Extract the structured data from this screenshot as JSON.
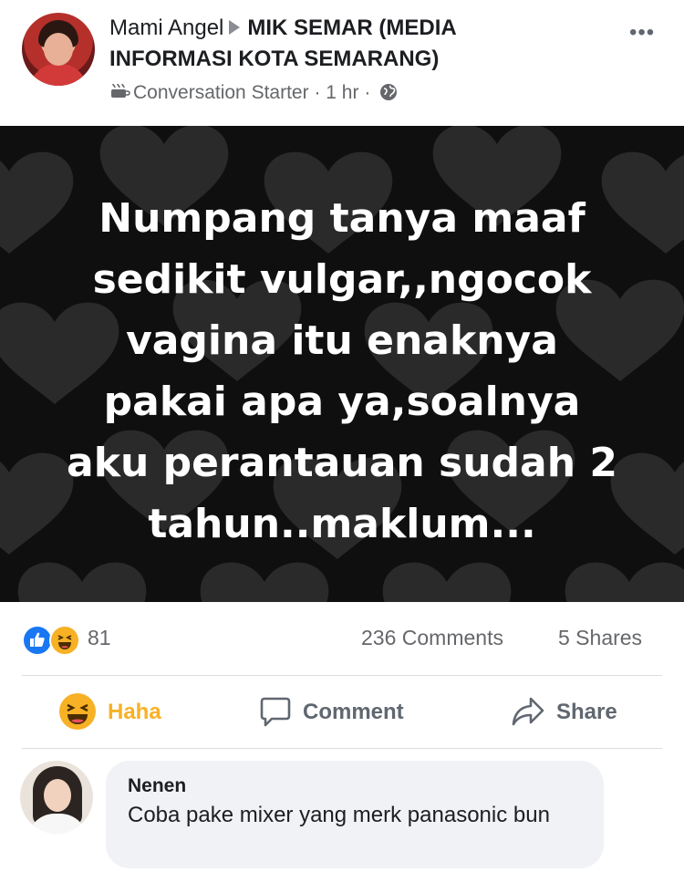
{
  "post": {
    "author": "Mami Angel",
    "group_line1": "MIK SEMAR (MEDIA",
    "group_line2": "INFORMASI KOTA SEMARANG)",
    "badge": "Conversation Starter",
    "separator": "·",
    "time": "1 hr",
    "privacy_icon": "globe-icon",
    "more_icon": "more-options-icon",
    "more_label": "•••",
    "image_text_lines": [
      "Numpang tanya maaf",
      "sedikit vulgar,,ngocok",
      "vagina itu enaknya",
      "pakai apa ya,soalnya",
      "aku perantauan sudah 2",
      "tahun..maklum..."
    ],
    "image_bg_color": "#0f0f0f"
  },
  "stats": {
    "reactions_count": "81",
    "comments": "236 Comments",
    "shares": "5 Shares"
  },
  "actions": {
    "haha": "Haha",
    "comment": "Comment",
    "share": "Share",
    "haha_color": "#f7b125"
  },
  "comment": {
    "name": "Nenen",
    "text": "Coba pake mixer yang merk panasonic bun"
  },
  "colors": {
    "like_blue": "#1877f2",
    "meta_gray": "#65676b",
    "bubble_bg": "#f0f2f5"
  }
}
